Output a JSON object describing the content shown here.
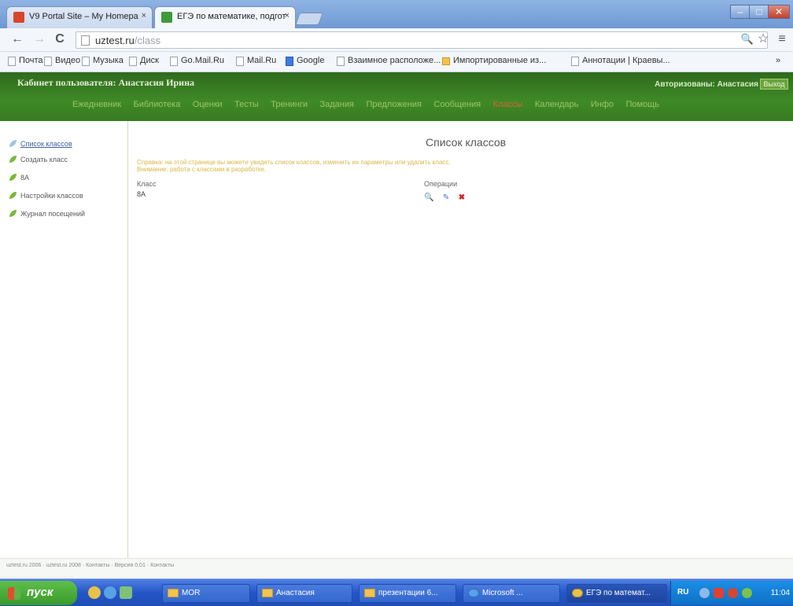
{
  "browser": {
    "tabs": [
      {
        "label": "V9 Portal Site – My Homepa",
        "favicon": "v9-favicon",
        "close": "×"
      },
      {
        "label": "ЕГЭ по математике, подгот",
        "favicon": "test-favicon",
        "close": "×"
      }
    ],
    "window_buttons": {
      "minimize": "–",
      "maximize": "□",
      "close": "✕"
    },
    "nav": {
      "back": "←",
      "forward": "→",
      "reload": "C"
    },
    "address": {
      "domain": "uztest.ru",
      "path": "/class"
    },
    "toolbar_icons": {
      "zoom": "🔍",
      "star": "☆",
      "menu": "≡"
    },
    "bookmarks": [
      {
        "label": "Почта",
        "icon": "page"
      },
      {
        "label": "Видео",
        "icon": "page"
      },
      {
        "label": "Музыка",
        "icon": "page"
      },
      {
        "label": "Диск",
        "icon": "page"
      },
      {
        "label": "Go.Mail.Ru",
        "icon": "page"
      },
      {
        "label": "Mail.Ru",
        "icon": "page"
      },
      {
        "label": "Google",
        "icon": "google"
      },
      {
        "label": "Взаимное расположе...",
        "icon": "page"
      },
      {
        "label": "Импортированные из...",
        "icon": "folder"
      },
      {
        "label": "Аннотации | Краевы...",
        "icon": "page"
      },
      {
        "label": "»",
        "icon": "none"
      }
    ]
  },
  "site": {
    "title": "Кабинет пользователя: Анастасия Ирина",
    "user_info": "Авторизованы: Анастасия",
    "logout": "Выход",
    "nav": [
      {
        "label": "Ежедневник",
        "active": false
      },
      {
        "label": "Библиотека",
        "active": false
      },
      {
        "label": "Оценки",
        "active": false
      },
      {
        "label": "Тесты",
        "active": false
      },
      {
        "label": "Тренинги",
        "active": false
      },
      {
        "label": "Задания",
        "active": false
      },
      {
        "label": "Предложения",
        "active": false
      },
      {
        "label": "Сообщения",
        "active": false
      },
      {
        "label": "Классы",
        "active": true
      },
      {
        "label": "Календарь",
        "active": false
      },
      {
        "label": "Инфо",
        "active": false
      },
      {
        "label": "Помощь",
        "active": false
      }
    ]
  },
  "sidebar": {
    "items": [
      {
        "label": "Список классов",
        "link": true
      },
      {
        "label": "Создать класс",
        "link": false
      },
      {
        "label": "8А",
        "link": false
      },
      {
        "label": "Настройки классов",
        "link": false
      },
      {
        "label": "Журнал посещений",
        "link": false
      }
    ]
  },
  "main": {
    "title": "Список классов",
    "help_line1": "Справка: на этой странице вы можете увидеть список классов, изменить их параметры или удалить класс.",
    "help_line2": "Внимание: работа с классами в разработке.",
    "columns": {
      "class": "Класс",
      "operations": "Операции"
    },
    "rows": [
      {
        "class": "8А",
        "ops": {
          "view": "🔍",
          "edit": "✎",
          "delete": "✖"
        }
      }
    ]
  },
  "footer": {
    "text": "uztest.ru 2006 · uztest.ru 2008 · Контакты · Версия 0.01 · Контакты"
  },
  "taskbar": {
    "start": "пуск",
    "tasks": [
      {
        "label": "MOR",
        "icon": "folder"
      },
      {
        "label": "Анастасия",
        "icon": "folder"
      },
      {
        "label": "презентации 6...",
        "icon": "folder"
      },
      {
        "label": "Microsoft ...",
        "icon": "ie"
      },
      {
        "label": "ЕГЭ по математ...",
        "icon": "chrome"
      }
    ],
    "lang": "RU",
    "clock": "11:04"
  },
  "colors": {
    "header_green": "#377a22",
    "nav_text": "#9cc46c",
    "nav_active": "#e06030",
    "help_text": "#d9b847",
    "taskbar_blue": "#2456c8",
    "start_green": "#3a9a2c"
  }
}
